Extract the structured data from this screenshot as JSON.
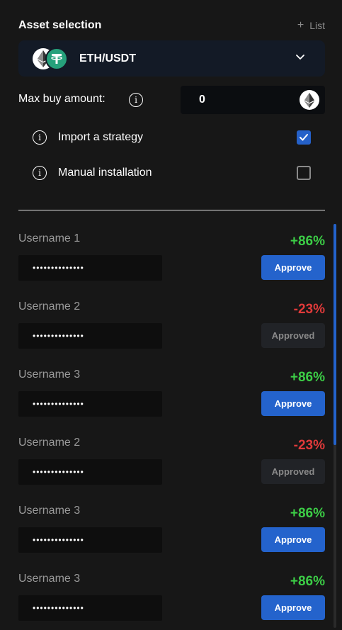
{
  "header": {
    "title": "Asset selection",
    "list_label": "List",
    "list_plus": "+"
  },
  "asset": {
    "pair": "ETH/USDT",
    "base_icon": "eth-icon",
    "quote_icon": "usdt-icon",
    "quote_symbol": "₮"
  },
  "max_buy": {
    "label": "Max buy amount:",
    "value": "0",
    "info": "i"
  },
  "options": [
    {
      "label": "Import a strategy",
      "checked": true,
      "info": "i"
    },
    {
      "label": "Manual installation",
      "checked": false,
      "info": "i"
    }
  ],
  "users": [
    {
      "name": "Username 1",
      "password": "••••••••••••••",
      "pct": "+86%",
      "trend": "pos",
      "status": "Approve"
    },
    {
      "name": "Username 2",
      "password": "••••••••••••••",
      "pct": "-23%",
      "trend": "neg",
      "status": "Approved"
    },
    {
      "name": "Username 3",
      "password": "••••••••••••••",
      "pct": "+86%",
      "trend": "pos",
      "status": "Approve"
    },
    {
      "name": "Username 2",
      "password": "••••••••••••••",
      "pct": "-23%",
      "trend": "neg",
      "status": "Approved"
    },
    {
      "name": "Username 3",
      "password": "••••••••••••••",
      "pct": "+86%",
      "trend": "pos",
      "status": "Approve"
    },
    {
      "name": "Username 3",
      "password": "••••••••••••••",
      "pct": "+86%",
      "trend": "pos",
      "status": "Approve"
    }
  ],
  "colors": {
    "accent": "#2463cc",
    "positive": "#3ccd46",
    "negative": "#e03a3a",
    "background": "#171717"
  }
}
